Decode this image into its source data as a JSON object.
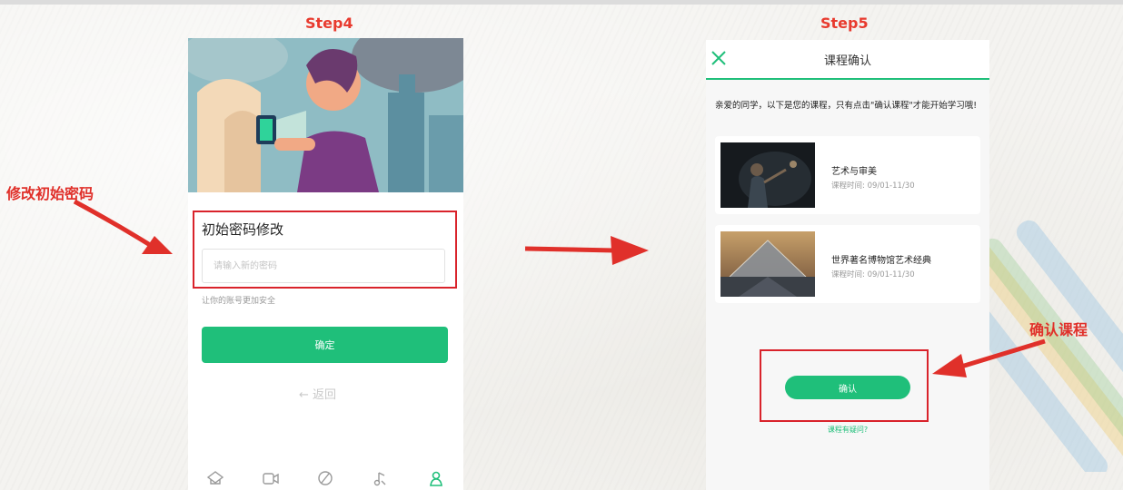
{
  "step4": {
    "title": "Step4",
    "form_title": "初始密码修改",
    "password_placeholder": "请输入新的密码",
    "hint": "让你的账号更加安全",
    "confirm_label": "确定",
    "back_label": "← 返回",
    "tabs": [
      "home-icon",
      "video-icon",
      "compass-icon",
      "music-icon",
      "profile-icon"
    ]
  },
  "step5": {
    "title": "Step5",
    "header_title": "课程确认",
    "intro": "亲爱的同学，以下是您的课程，只有点击\"确认课程\"才能开始学习哦!",
    "courses": [
      {
        "title": "艺术与审美",
        "time": "课程时间: 09/01-11/30"
      },
      {
        "title": "世界著名博物馆艺术经典",
        "time": "课程时间: 09/01-11/30"
      }
    ],
    "confirm_label": "确认",
    "question_link": "课程有疑问?"
  },
  "annotations": {
    "left": "修改初始密码",
    "right": "确认课程"
  },
  "colors": {
    "accent_green": "#1fbf7a",
    "annotation_red": "#e0302a",
    "box_red": "#d9232b"
  }
}
